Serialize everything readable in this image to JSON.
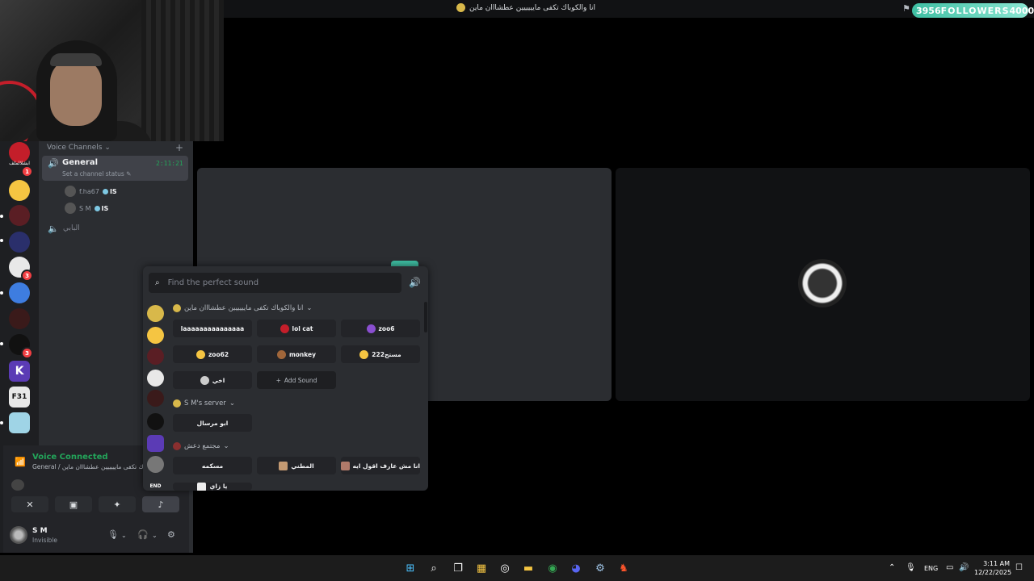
{
  "top": {
    "title": "انا والكوباك تكفى مايييييين عطشااان ماين",
    "followers_count": "3956",
    "followers_label": "FOLLOWERS",
    "followers_goal": "4000"
  },
  "rail": {
    "server_label": "ابشلالملف",
    "badges": [
      "1",
      "3",
      "3"
    ],
    "f31_label": "F31"
  },
  "channels": {
    "header": "Voice Channels",
    "active": {
      "name": "General",
      "status": "Set a channel status",
      "timer": "2:11:21"
    },
    "members": [
      {
        "name": "f.ha67",
        "tag": "IS"
      },
      {
        "name": "S M",
        "tag": "IS"
      }
    ],
    "other_channel": "البابي"
  },
  "voice": {
    "title": "Voice Connected",
    "subtitle": "General / انا والكوباك تكفى مايييييين عطشااان ماين"
  },
  "user": {
    "name": "S M",
    "status": "Invisible"
  },
  "soundboard": {
    "search_placeholder": "Find the perfect sound",
    "groups": [
      {
        "name": "انا والكوباك تكفى مايييييين عطشااان ماين"
      },
      {
        "name": "S M's server"
      },
      {
        "name": "مجتمع دعش"
      }
    ],
    "sounds": [
      {
        "label": "laaaaaaaaaaaaaaa"
      },
      {
        "label": "lol cat"
      },
      {
        "label": "zoo6"
      },
      {
        "label": "zoo62"
      },
      {
        "label": "monkey"
      },
      {
        "label": "مستح222"
      },
      {
        "label": "اخي"
      },
      {
        "label": "ابو مرسال"
      },
      {
        "label": "مسكمه"
      },
      {
        "label": "المطني"
      },
      {
        "label": "انا مش عارف اقول ايه"
      },
      {
        "label": "يا زاي"
      }
    ],
    "add_label": "Add Sound",
    "rail_label": "END"
  },
  "taskbar": {
    "lang": "ENG",
    "time": "3:11 AM",
    "date": "12/22/2025"
  },
  "colors": {
    "accent_green": "#23a55a",
    "followers_bg": "#3fbfa3",
    "badge_red": "#f23f43"
  }
}
